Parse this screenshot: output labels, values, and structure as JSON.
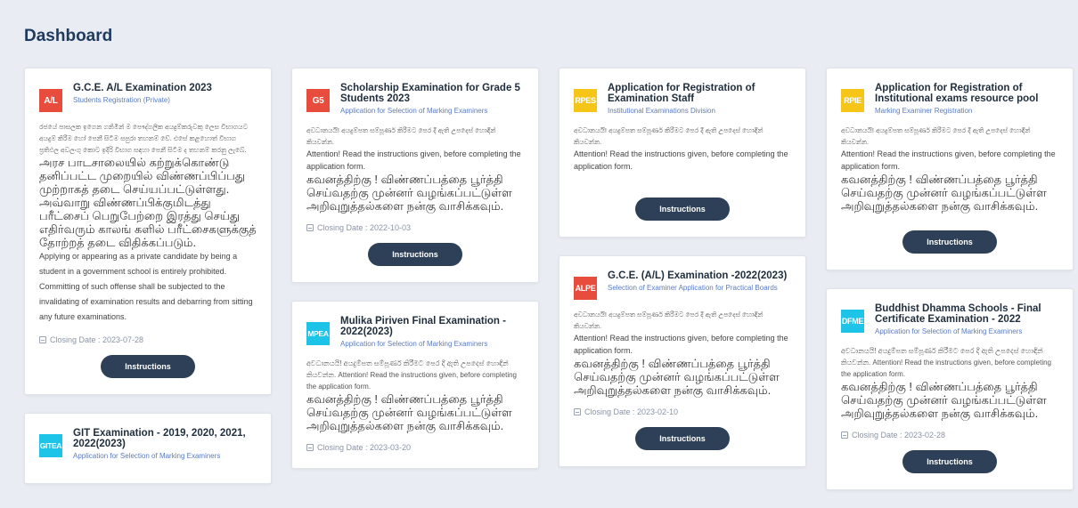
{
  "page": {
    "title": "Dashboard"
  },
  "colors": {
    "red": "#e74c3c",
    "yellow": "#f5c518",
    "cyan": "#1ec3e8",
    "button": "#2e4057"
  },
  "cards": [
    {
      "badge": "A/L",
      "badge_color": "#e74c3c",
      "title": "G.C.E. A/L Examination 2023",
      "subtitle": "Students Registration (Private)",
      "si": "රජයේ පාසලක ඉගෙන ගනිමින් ම පෞද්ගලික අයදුම්කරුවකු ලෙස විභාගයට අයදුම් කිරීම හෝ පෙනී සිටීම සපුරා තහනම් වේ. එසේ කළහොත් විභාග ප්‍රතිඵල අවලංගු කොට ඉදිරි විභාග සඳහා පෙනී සිටීම ද තහනම් කරනු ලැබේ.",
      "ta": "அரச பாடசாலையில் கற்றுக்கொண்டு தனிப்பட்ட முறையில் விண்ணப்பிப்பது முற்றாகத் தடை செய்யப்பட்டுள்ளது. அவ்வாறு விண்ணப்பிக்குமிடத்து பரீட்சைப் பெறுபேற்றை இரத்து செய்து எதிர்வரும் காலங் களில் பரீட்சைகளுக்குத் தோற்றத் தடை விதிக்கப்படும்.",
      "en": "Applying or appearing as a private candidate by being a student in a government school is entirely prohibited. Committing of such offense shall be subjected to the invalidating of examination results and debarring from sitting any future examinations.",
      "closing": "Closing Date : 2023-07-28",
      "button": "Instructions"
    },
    {
      "badge": "GITEA",
      "badge_color": "#1ec3e8",
      "title": "GIT Examination - 2019, 2020, 2021, 2022(2023)",
      "subtitle": "Application for Selection of Marking Examiners"
    },
    {
      "badge": "G5",
      "badge_color": "#e74c3c",
      "title": "Scholarship Examination for Grade 5 Students 2023",
      "subtitle": "Application for Selection of Marking Examiners",
      "si": "අවධානයයි! අයදුම්පත සම්පූර්ණ කිරීමට පෙර දී ඇති උපදෙස් හොඳින් කියවන්න.",
      "en": "Attention! Read the instructions given, before completing the application form.",
      "ta": "கவனத்திற்கு ! விண்ணப்பத்தை பூர்த்தி செய்வதற்கு முன்னர் வழங்கப்பட்டுள்ள அறிவுறுத்தல்களை நன்கு வாசிக்கவும்.",
      "closing": "Closing Date : 2022-10-03",
      "button": "Instructions"
    },
    {
      "badge": "MPEA",
      "badge_color": "#1ec3e8",
      "title": "Mulika Piriven Final Examination - 2022(2023)",
      "subtitle": "Application for Selection of Marking Examiners",
      "si_en": "අවධානයයි! අයදුම්පත සම්පූර්ණ කිරීමට පෙර දී ඇති උපදෙස් හොඳින් කියවන්න. Attention! Read the instructions given, before completing the application form.",
      "ta": "கவனத்திற்கு ! விண்ணப்பத்தை பூர்த்தி செய்வதற்கு முன்னர் வழங்கப்பட்டுள்ள அறிவுறுத்தல்களை நன்கு வாசிக்கவும்.",
      "closing": "Closing Date : 2023-03-20"
    },
    {
      "badge": "RPES",
      "badge_color": "#f5c518",
      "title": "Application for Registration of Examination Staff",
      "subtitle": "Institutional Examinations Division",
      "si": "අවධානයයි! අයදුම්පත සම්පූර්ණ කිරීමට පෙර දී ඇති උපදෙස් හොඳින් කියවන්න.",
      "en": "Attention! Read the instructions given, before completing the application form.",
      "button": "Instructions"
    },
    {
      "badge": "ALPE",
      "badge_color": "#e74c3c",
      "title": "G.C.E. (A/L) Examination -2022(2023)",
      "subtitle": "Selection of Examiner Application for Practical Boards",
      "si": "අවධානයයි! අයදුම්පත සම්පූර්ණ කිරීමට පෙර දී ඇති උපදෙස් හොඳින් කියවන්න.",
      "en": "Attention! Read the instructions given, before completing the application form.",
      "ta": "கவனத்திற்கு ! விண்ணப்பத்தை பூர்த்தி செய்வதற்கு முன்னர் வழங்கப்பட்டுள்ள அறிவுறுத்தல்களை நன்கு வாசிக்கவும்.",
      "closing": "Closing Date : 2023-02-10",
      "button": "Instructions"
    },
    {
      "badge": "RPIE",
      "badge_color": "#f5c518",
      "title": "Application for Registration of Institutional exams resource pool",
      "subtitle": "Marking Examiner Registration",
      "si": "අවධානයයි! අයදුම්පත සම්පූර්ණ කිරීමට පෙර දී ඇති උපදෙස් හොඳින් කියවන්න.",
      "en": "Attention! Read the instructions given, before completing the application form.",
      "ta": "கவனத்திற்கு ! விண்ணப்பத்தை பூர்த்தி செய்வதற்கு முன்னர் வழங்கப்பட்டுள்ள அறிவுறுத்தல்களை நன்கு வாசிக்கவும்.",
      "button": "Instructions"
    },
    {
      "badge": "DFME",
      "badge_color": "#1ec3e8",
      "title": "Buddhist Dhamma Schools - Final Certificate Examination - 2022",
      "subtitle": "Application for Selection of Marking Examiners",
      "si_en": "අවධානයයි! අයදුම්පත සම්පූර්ණ කිරීමට පෙර දී ඇති උපදෙස් හොඳින් කියවන්න. Attention! Read the instructions given, before completing the application form.",
      "ta": "கவனத்திற்கு ! விண்ணப்பத்தை பூர்த்தி செய்வதற்கு முன்னர் வழங்கப்பட்டுள்ள அறிவுறுத்தல்களை நன்கு வாசிக்கவும்.",
      "closing": "Closing Date : 2023-02-28",
      "button": "Instructions"
    }
  ]
}
